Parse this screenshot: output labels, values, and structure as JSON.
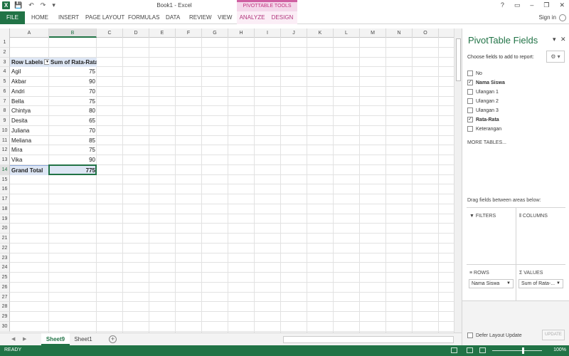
{
  "window": {
    "title": "Book1 - Excel",
    "context_group": "PIVOTTABLE TOOLS",
    "logo": "X",
    "controls": [
      "?",
      "▭",
      "–",
      "❐",
      "✕"
    ]
  },
  "ribbon": {
    "tabs": [
      "FILE",
      "HOME",
      "INSERT",
      "PAGE LAYOUT",
      "FORMULAS",
      "DATA",
      "REVIEW",
      "VIEW",
      "ANALYZE",
      "DESIGN"
    ],
    "signin": "Sign in"
  },
  "grid": {
    "columns": [
      "A",
      "B",
      "C",
      "D",
      "E",
      "F",
      "G",
      "H",
      "I",
      "J",
      "K",
      "L",
      "M",
      "N",
      "O"
    ],
    "row_count": 30,
    "selected_column": "B",
    "selected_row": 14
  },
  "pivot": {
    "row_labels_header": "Row Labels",
    "values_header": "Sum of Rata-Rata",
    "rows": [
      {
        "label": "Agil",
        "value": "75"
      },
      {
        "label": "Akbar",
        "value": "90"
      },
      {
        "label": "Andri",
        "value": "70"
      },
      {
        "label": "Bella",
        "value": "75"
      },
      {
        "label": "Chintya",
        "value": "80"
      },
      {
        "label": "Desita",
        "value": "65"
      },
      {
        "label": "Juliana",
        "value": "70"
      },
      {
        "label": "Meliana",
        "value": "85"
      },
      {
        "label": "Mira",
        "value": "75"
      },
      {
        "label": "Vika",
        "value": "90"
      }
    ],
    "total_label": "Grand Total",
    "total_value": "775"
  },
  "sheets": {
    "tabs": [
      "Sheet9",
      "Sheet1"
    ],
    "active": "Sheet9"
  },
  "status": {
    "ready": "READY",
    "zoom": "100%"
  },
  "pane": {
    "title": "PivotTable Fields",
    "choose_label": "Choose fields to add to report:",
    "fields": [
      {
        "name": "No",
        "checked": false
      },
      {
        "name": "Nama Siswa",
        "checked": true
      },
      {
        "name": "Ulangan 1",
        "checked": false
      },
      {
        "name": "Ulangan 2",
        "checked": false
      },
      {
        "name": "Ulangan 3",
        "checked": false
      },
      {
        "name": "Rata-Rata",
        "checked": true
      },
      {
        "name": "Keterangan",
        "checked": false
      }
    ],
    "more_tables": "MORE TABLES...",
    "drag_label": "Drag fields between areas below:",
    "areas": {
      "filters": "FILTERS",
      "columns": "COLUMNS",
      "rows": "ROWS",
      "values": "VALUES"
    },
    "rows_item": "Nama Siswa",
    "values_item": "Sum of Rata-...",
    "defer_label": "Defer Layout Update",
    "update_label": "UPDATE"
  }
}
